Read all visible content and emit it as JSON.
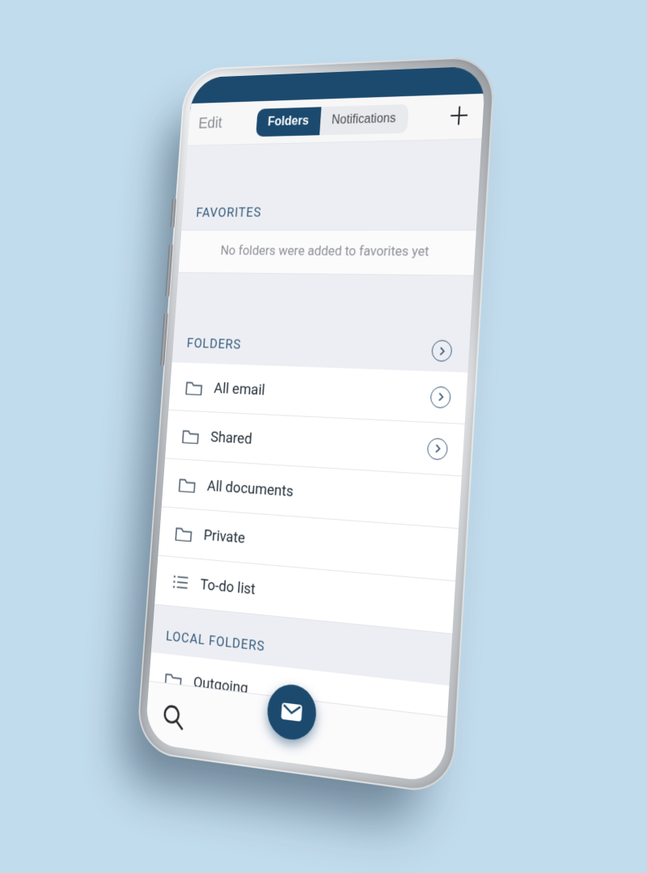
{
  "colors": {
    "accent": "#1c4a6e",
    "page_bg": "#c1dced"
  },
  "topbar": {
    "edit_label": "Edit",
    "tabs": {
      "folders": "Folders",
      "notifications": "Notifications",
      "active": "folders"
    },
    "add_label": "+"
  },
  "sections": {
    "favorites": {
      "title": "FAVORITES",
      "empty_message": "No folders were added to favorites yet"
    },
    "folders": {
      "title": "FOLDERS",
      "items": [
        {
          "label": "All email",
          "icon": "folder-icon",
          "has_chevron": true
        },
        {
          "label": "Shared",
          "icon": "folder-icon",
          "has_chevron": true
        },
        {
          "label": "All documents",
          "icon": "folder-icon",
          "has_chevron": false
        },
        {
          "label": "Private",
          "icon": "folder-icon",
          "has_chevron": false
        },
        {
          "label": "To-do list",
          "icon": "list-icon",
          "has_chevron": false
        }
      ]
    },
    "local": {
      "title": "LOCAL FOLDERS",
      "items": [
        {
          "label": "Outgoing",
          "icon": "folder-icon",
          "has_chevron": false
        }
      ]
    }
  },
  "bottombar": {
    "search_label": "Search",
    "compose_label": "Compose"
  }
}
